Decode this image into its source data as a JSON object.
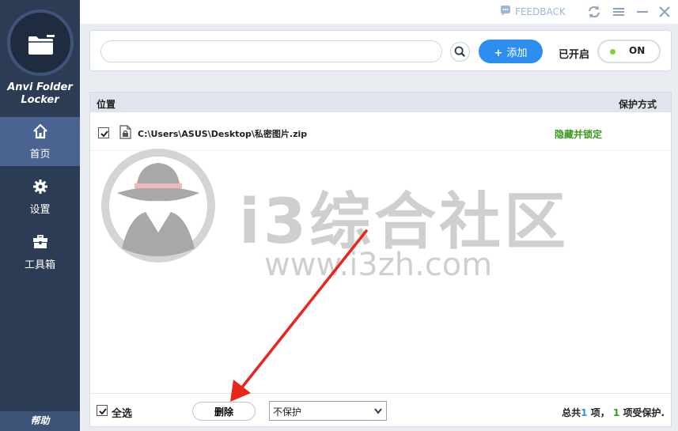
{
  "app": {
    "name_line1": "Anvi Folder",
    "name_line2": "Locker",
    "help_label": "帮助"
  },
  "sidebar": {
    "items": [
      {
        "label": "首页",
        "icon": "home-icon",
        "active": true
      },
      {
        "label": "设置",
        "icon": "gear-icon",
        "active": false
      },
      {
        "label": "工具箱",
        "icon": "toolbox-icon",
        "active": false
      }
    ]
  },
  "titlebar": {
    "feedback_label": "FEEDBACK"
  },
  "toolbar": {
    "search_value": "",
    "add_label": "添加",
    "status_label": "已开启",
    "toggle_label": "ON"
  },
  "table": {
    "col_location": "位置",
    "col_protection": "保护方式",
    "rows": [
      {
        "checked": true,
        "path": "C:\\Users\\ASUS\\Desktop\\私密图片.zip",
        "protection": "隐藏并锁定"
      }
    ]
  },
  "watermark": {
    "title": "i3综合社区",
    "url": "www.i3zh.com"
  },
  "footer": {
    "select_all_label": "全选",
    "delete_label": "删除",
    "mode_value": "不保护",
    "summary_prefix": "总共",
    "total_count": "1",
    "summary_mid": "项，",
    "protected_count": "1",
    "summary_suffix": "项受保护."
  },
  "colors": {
    "sidebar_bg": "#2d3c55",
    "sidebar_active": "#4a6390",
    "accent_blue": "#2d8ef0",
    "status_green": "#3a9a1c",
    "toggle_dot": "#7ed33a",
    "arrow_red": "#e8261b"
  }
}
